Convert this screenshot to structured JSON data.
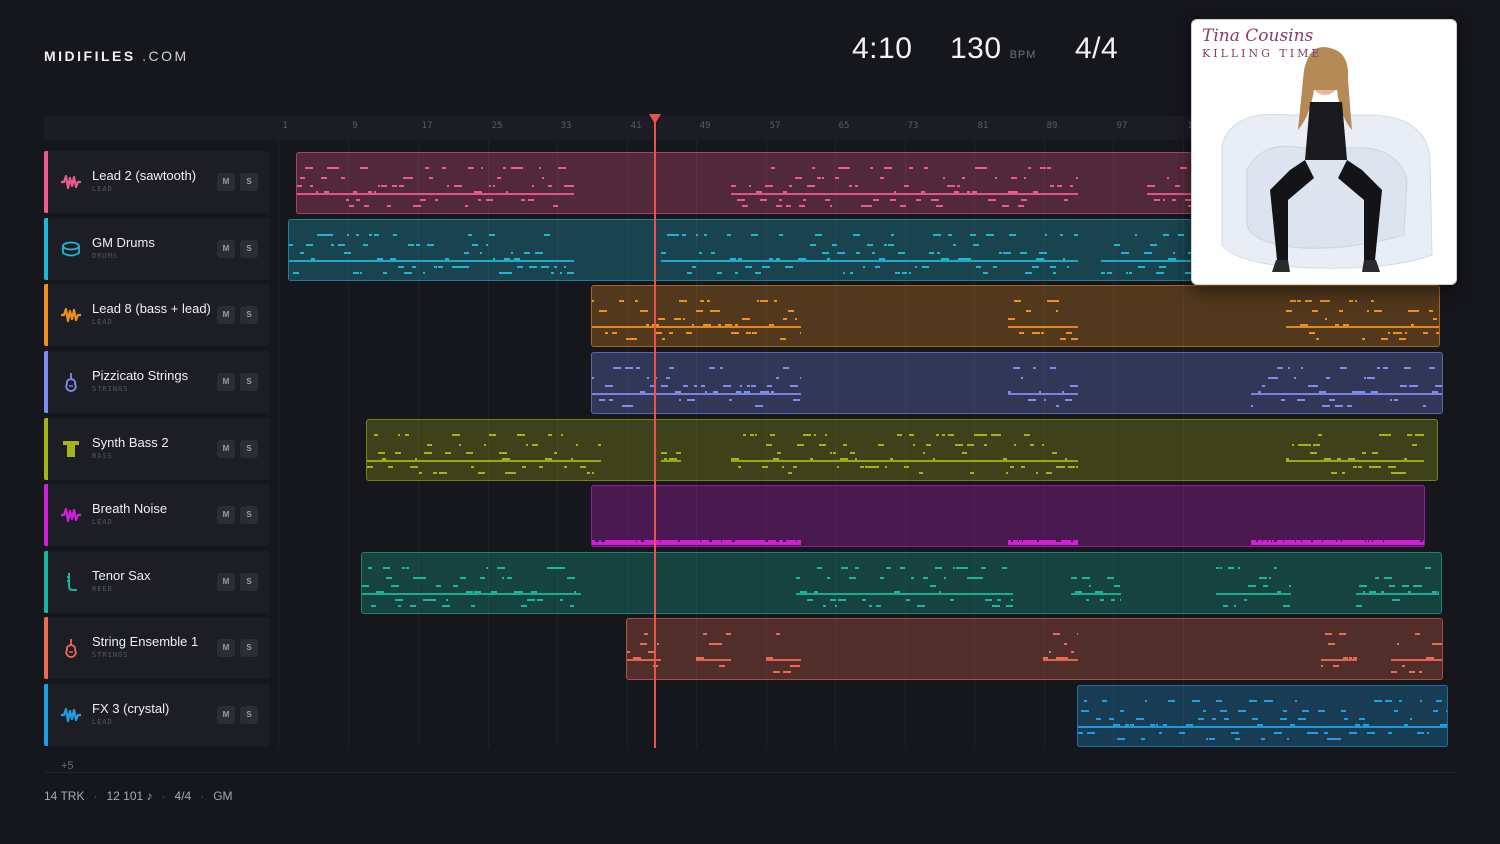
{
  "brand": {
    "name": "MIDIFILES",
    "suffix": ".COM"
  },
  "transport": {
    "time": "4:10",
    "bpm": "130",
    "bpm_unit": "BPM",
    "signature": "4/4"
  },
  "ruler": [
    "1",
    "9",
    "17",
    "25",
    "33",
    "41",
    "49",
    "57",
    "65",
    "73",
    "81",
    "89",
    "97",
    "1"
  ],
  "tracks": [
    {
      "name": "Lead 2 (sawtooth)",
      "category": "LEAD",
      "color": "#ef5a8c",
      "icon": "waveform-icon",
      "mute": "M",
      "solo": "S"
    },
    {
      "name": "GM Drums",
      "category": "DRUMS",
      "color": "#1fb6d3",
      "icon": "drum-icon",
      "mute": "M",
      "solo": "S"
    },
    {
      "name": "Lead 8 (bass + lead)",
      "category": "LEAD",
      "color": "#f0901f",
      "icon": "waveform-icon",
      "mute": "M",
      "solo": "S"
    },
    {
      "name": "Pizzicato Strings",
      "category": "STRINGS",
      "color": "#7f8cf2",
      "icon": "violin-icon",
      "mute": "M",
      "solo": "S"
    },
    {
      "name": "Synth Bass 2",
      "category": "BASS",
      "color": "#a4b414",
      "icon": "bass-icon",
      "mute": "M",
      "solo": "S"
    },
    {
      "name": "Breath Noise",
      "category": "LEAD",
      "color": "#d21fd8",
      "icon": "waveform-icon",
      "mute": "M",
      "solo": "S"
    },
    {
      "name": "Tenor Sax",
      "category": "REED",
      "color": "#19b89c",
      "icon": "sax-icon",
      "mute": "M",
      "solo": "S"
    },
    {
      "name": "String Ensemble 1",
      "category": "STRINGS",
      "color": "#ef6a52",
      "icon": "violin-icon",
      "mute": "M",
      "solo": "S"
    },
    {
      "name": "FX 3 (crystal)",
      "category": "LEAD",
      "color": "#1f9fe6",
      "icon": "waveform-icon",
      "mute": "M",
      "solo": "S"
    }
  ],
  "more_tracks": "+5",
  "footer": {
    "tracks": "14 TRK",
    "notes": "12 101 ♪",
    "signature": "4/4",
    "standard": "GM"
  },
  "cover": {
    "artist": "Tina Cousins",
    "album": "KILLING TIME"
  }
}
